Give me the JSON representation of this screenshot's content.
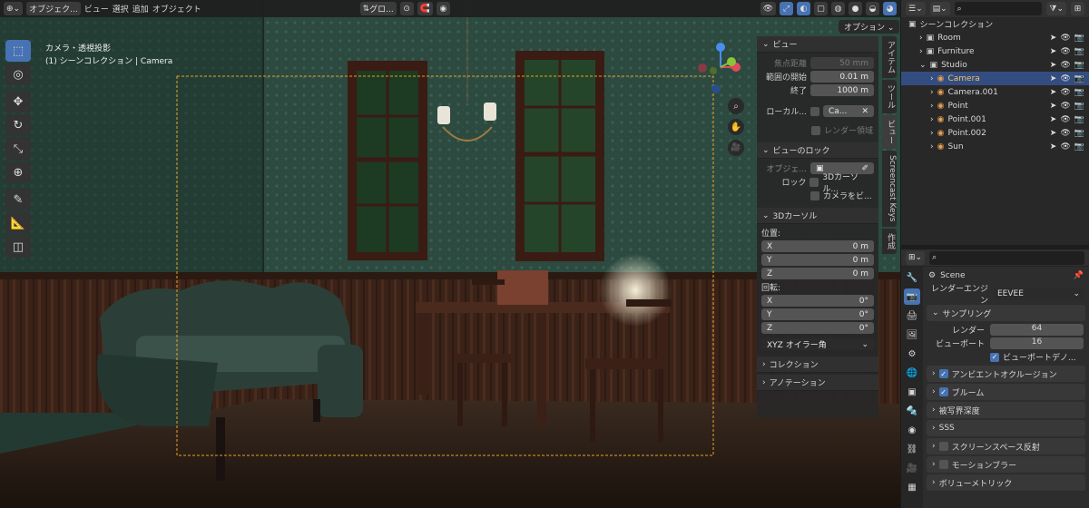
{
  "header": {
    "object_mode": "オブジェク...",
    "menus": [
      "ビュー",
      "選択",
      "追加",
      "オブジェクト"
    ],
    "orientation": "グロ...",
    "options": "オプション"
  },
  "viewport": {
    "camera_title": "カメラ・透視投影",
    "camera_sub": "(1) シーンコレクション | Camera"
  },
  "npanel": {
    "view_header": "ビュー",
    "focal_label": "焦点距離",
    "focal_value": "50 mm",
    "clip_start_label": "範囲の開始",
    "clip_start_value": "0.01 m",
    "clip_end_label": "終了",
    "clip_end_value": "1000 m",
    "local_label": "ローカル...",
    "local_value": "Ca...",
    "render_region": "レンダー領域",
    "view_lock_header": "ビューのロック",
    "lock_object_label": "オブジェ...",
    "lock_label": "ロック",
    "lock_3d_cursor": "3Dカーソル...",
    "lock_camera": "カメラをビ...",
    "cursor_header": "3Dカーソル",
    "location_label": "位置:",
    "loc": [
      {
        "axis": "X",
        "value": "0 m"
      },
      {
        "axis": "Y",
        "value": "0 m"
      },
      {
        "axis": "Z",
        "value": "0 m"
      }
    ],
    "rotation_label": "回転:",
    "rot": [
      {
        "axis": "X",
        "value": "0°"
      },
      {
        "axis": "Y",
        "value": "0°"
      },
      {
        "axis": "Z",
        "value": "0°"
      }
    ],
    "rot_mode": "XYZ オイラー角",
    "collection_header": "コレクション",
    "annotation_header": "アノテーション"
  },
  "vtabs": [
    "アイテム",
    "ツール",
    "ビュー",
    "Screencast Keys",
    "作成"
  ],
  "outliner": {
    "root": "シーンコレクション",
    "items": [
      {
        "name": "Room",
        "indent": 1,
        "selected": false
      },
      {
        "name": "Furniture",
        "indent": 1,
        "selected": false
      },
      {
        "name": "Studio",
        "indent": 1,
        "selected": false
      },
      {
        "name": "Camera",
        "indent": 2,
        "selected": true
      },
      {
        "name": "Camera.001",
        "indent": 2,
        "selected": false
      },
      {
        "name": "Point",
        "indent": 2,
        "selected": false
      },
      {
        "name": "Point.001",
        "indent": 2,
        "selected": false
      },
      {
        "name": "Point.002",
        "indent": 2,
        "selected": false
      },
      {
        "name": "Sun",
        "indent": 2,
        "selected": false
      }
    ]
  },
  "properties": {
    "scene": "Scene",
    "render_engine_label": "レンダーエンジン",
    "render_engine_value": "EEVEE",
    "sampling": "サンプリング",
    "render_label": "レンダー",
    "render_value": "64",
    "viewport_label": "ビューポート",
    "viewport_value": "16",
    "viewport_denoise": "ビューポートデノ...",
    "sections": [
      {
        "label": "アンビエントオクルージョン",
        "checked": true
      },
      {
        "label": "ブルーム",
        "checked": true
      },
      {
        "label": "被写界深度",
        "checked": null
      },
      {
        "label": "SSS",
        "checked": null
      },
      {
        "label": "スクリーンスペース反射",
        "checked": false
      },
      {
        "label": "モーションブラー",
        "checked": false
      },
      {
        "label": "ボリューメトリック",
        "checked": null
      }
    ]
  }
}
